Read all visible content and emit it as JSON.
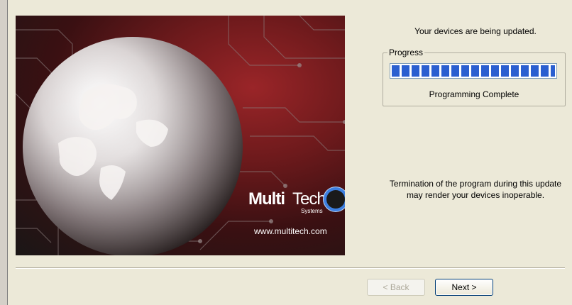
{
  "banner": {
    "logo_multi": "Multi",
    "logo_tech": "Tech",
    "logo_sub": "Systems",
    "url": "www.multitech.com"
  },
  "status": {
    "heading": "Your devices are being updated.",
    "group_label": "Progress",
    "progress_fraction": 1.0,
    "progress_text": "Programming Complete",
    "warning": "Termination of the program during this update may render your devices inoperable."
  },
  "buttons": {
    "back": "< Back",
    "next": "Next >"
  },
  "colors": {
    "progress": "#2b5fd0",
    "dialog_bg": "#ece9d8"
  }
}
